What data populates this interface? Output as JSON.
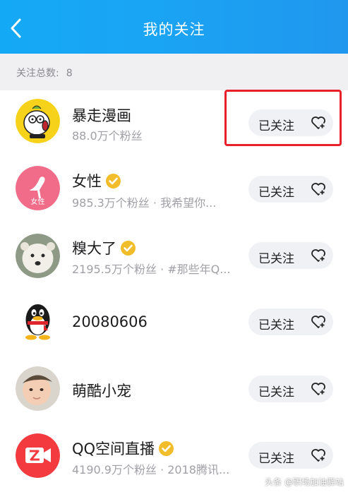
{
  "header": {
    "title": "我的关注",
    "back_icon": "chevron-left-icon"
  },
  "summary": {
    "label": "关注总数:",
    "count": "8"
  },
  "follow_label": "已关注",
  "colors": {
    "header_accent": "#1aa5f4",
    "badge": "#f2bd2b",
    "highlight": "#e8202a"
  },
  "items": [
    {
      "name": "暴走漫画",
      "desc": "88.0万个粉丝",
      "verified": false,
      "avatar": "baozou-avatar"
    },
    {
      "name": "女性",
      "desc": "985.3万个粉丝 · 我希望你...",
      "verified": true,
      "avatar": "nvxing-avatar",
      "avatar_text": "女性"
    },
    {
      "name": "糗大了",
      "desc": "2195.5万个粉丝 · #那些年Q...",
      "verified": true,
      "avatar": "polar-bear-avatar"
    },
    {
      "name": "20080606",
      "desc": "",
      "verified": false,
      "avatar": "qq-penguin-avatar"
    },
    {
      "name": "萌酷小宠",
      "desc": "",
      "verified": false,
      "avatar": "baby-avatar"
    },
    {
      "name": "QQ空间直播",
      "desc": "4190.9万个粉丝 · 2018腾讯...",
      "verified": true,
      "avatar": "qzone-live-avatar"
    }
  ],
  "watermark": "头条 @职场加油驿站"
}
